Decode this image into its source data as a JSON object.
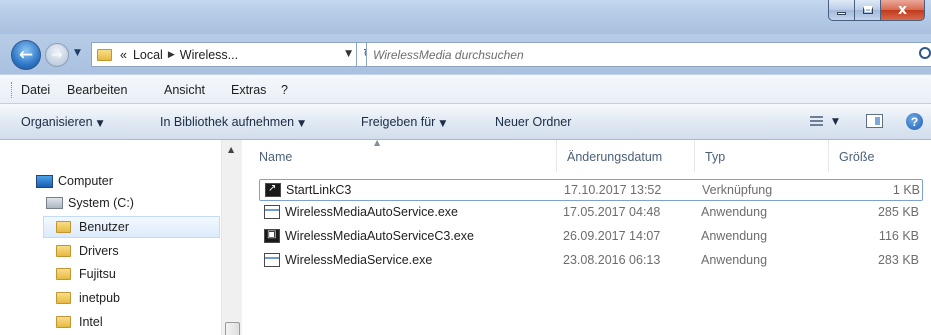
{
  "window": {
    "close_glyph": "x"
  },
  "address_bar": {
    "path": [
      "«",
      "Local",
      "Wireless..."
    ],
    "search_placeholder": "WirelessMedia durchsuchen"
  },
  "menu": [
    "Datei",
    "Bearbeiten",
    "Ansicht",
    "Extras",
    "?"
  ],
  "commands": {
    "organize": "Organisieren",
    "library": "In Bibliothek aufnehmen",
    "share": "Freigeben für",
    "new_folder": "Neuer Ordner"
  },
  "nav_pane": {
    "items": [
      {
        "label": "Computer",
        "icon": "computer-icon"
      },
      {
        "label": "System (C:)",
        "icon": "drive-icon"
      },
      {
        "label": "Benutzer",
        "icon": "folder-icon",
        "selected": true
      },
      {
        "label": "Drivers",
        "icon": "folder-icon"
      },
      {
        "label": "Fujitsu",
        "icon": "folder-icon"
      },
      {
        "label": "inetpub",
        "icon": "folder-icon"
      },
      {
        "label": "Intel",
        "icon": "folder-icon"
      }
    ]
  },
  "file_list": {
    "columns": [
      "Name",
      "Änderungsdatum",
      "Typ",
      "Größe"
    ],
    "rows": [
      {
        "name": "StartLinkC3",
        "date": "17.10.2017 13:52",
        "type": "Verknüpfung",
        "size": "1 KB",
        "icon": "shortcut-icon"
      },
      {
        "name": "WirelessMediaAutoService.exe",
        "date": "17.05.2017 04:48",
        "type": "Anwendung",
        "size": "285 KB",
        "icon": "application-icon"
      },
      {
        "name": "WirelessMediaAutoServiceC3.exe",
        "date": "26.09.2017 14:07",
        "type": "Anwendung",
        "size": "116 KB",
        "icon": "black-app-icon"
      },
      {
        "name": "WirelessMediaService.exe",
        "date": "23.08.2016 06:13",
        "type": "Anwendung",
        "size": "283 KB",
        "icon": "application-icon"
      }
    ]
  }
}
